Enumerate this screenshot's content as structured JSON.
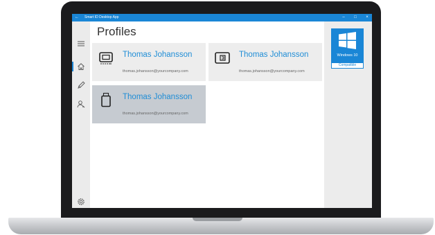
{
  "window": {
    "title": "Smart ID Desktop App",
    "back_icon": "arrow-left-icon",
    "controls": {
      "minimize": "–",
      "maximize": "□",
      "close": "×"
    },
    "accent_color": "#1a86d6"
  },
  "sidebar": {
    "items": [
      {
        "name": "menu",
        "icon": "hamburger-menu-icon"
      },
      {
        "name": "home",
        "icon": "home-icon",
        "selected": true
      },
      {
        "name": "edit",
        "icon": "pencil-icon"
      },
      {
        "name": "users",
        "icon": "person-icon"
      },
      {
        "name": "settings",
        "icon": "gear-icon"
      }
    ]
  },
  "main": {
    "title": "Profiles",
    "profiles": [
      {
        "name": "Thomas Johansson",
        "email": "thomas.johansson@yourcompany.com",
        "icon": "smart-card-chip-icon",
        "selected": false
      },
      {
        "name": "Thomas Johansson",
        "email": "thomas.johansson@yourcompany.com",
        "icon": "tablet-device-icon",
        "selected": false
      },
      {
        "name": "Thomas Johansson",
        "email": "thomas.johansson@yourcompany.com",
        "icon": "usb-token-icon",
        "selected": true
      }
    ]
  },
  "badge": {
    "product": "Windows 10",
    "label": "Compatible",
    "icon": "windows-logo-icon"
  }
}
